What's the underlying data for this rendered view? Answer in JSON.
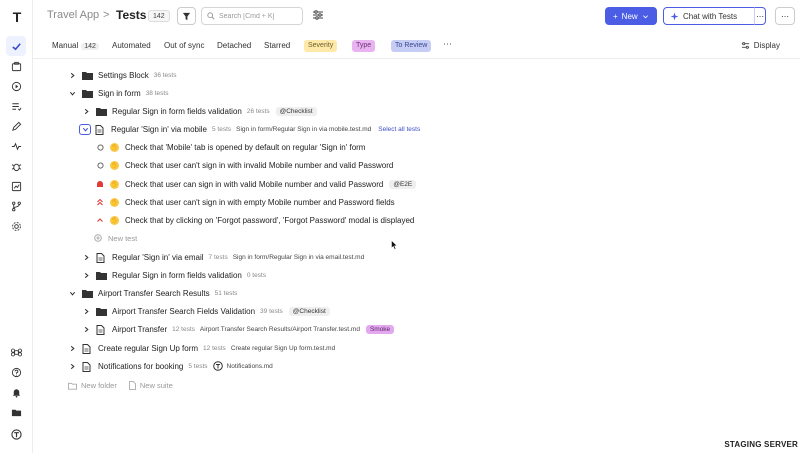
{
  "app": {
    "name": "Travel App",
    "separator": ">",
    "page_title": "Tests",
    "test_count": "142"
  },
  "search": {
    "placeholder": "Search [Cmd + K]"
  },
  "toolbar": {
    "new_label": "New",
    "chat_label": "Chat with Tests",
    "more": "⋯"
  },
  "tabs": {
    "manual": "Manual",
    "manual_count": "142",
    "automated": "Automated",
    "out_of_sync": "Out of sync",
    "detached": "Detached",
    "starred": "Starred",
    "severity": "Severity",
    "type": "Type",
    "to_review": "To Review",
    "more": "⋯",
    "display": "Display"
  },
  "tree": {
    "settings_block": {
      "title": "Settings Block",
      "count": "36 tests"
    },
    "sign_in_form": {
      "title": "Sign in form",
      "count": "38 tests"
    },
    "regular_sign_in_validation": {
      "title": "Regular Sign in form fields validation",
      "count": "26 tests",
      "tag": "@Checklist"
    },
    "via_mobile": {
      "title": "Regular 'Sign in' via mobile",
      "count": "5 tests",
      "path": "Sign in form/Regular Sign in via mobile.test.md",
      "select_all": "Select all tests"
    },
    "tests": [
      {
        "title": "Check that 'Mobile' tab is opened by default on regular 'Sign in' form"
      },
      {
        "title": "Check that user can't sign in with invalid Mobile number and valid Password"
      },
      {
        "title": "Check that user can sign in with valid Mobile number and valid Password",
        "tag": "@E2E"
      },
      {
        "title": "Check that user can't sign in with empty Mobile number and Password fields"
      },
      {
        "title": "Check that by clicking on 'Forgot password', 'Forgot Password' modal is displayed"
      }
    ],
    "new_test": "New test",
    "via_email": {
      "title": "Regular 'Sign in' via email",
      "count": "7 tests",
      "path": "Sign in form/Regular Sign in via email.test.md"
    },
    "fields_validation": {
      "title": "Regular Sign in form fields validation",
      "count": "0 tests"
    },
    "airport_search": {
      "title": "Airport Transfer Search Results",
      "count": "51 tests"
    },
    "airport_fields": {
      "title": "Airport Transfer Search Fields Validation",
      "count": "39 tests",
      "tag": "@Checklist"
    },
    "airport_transfer": {
      "title": "Airport Transfer",
      "count": "12 tests",
      "path": "Airport Transfer Search Results/Airport Transfer.test.md",
      "tag": "Smoke"
    },
    "create_signup": {
      "title": "Create regular Sign Up form",
      "count": "12 tests",
      "path": "Create regular Sign Up form.test.md"
    },
    "notifications": {
      "title": "Notifications for booking",
      "count": "5 tests",
      "path": "Notifications.md"
    },
    "new_folder": "New folder",
    "new_suite": "New suite"
  },
  "footer": {
    "environment": "STAGING SERVER"
  },
  "colors": {
    "accent": "#4b5de4",
    "severity": "#ffe9a8",
    "type": "#e8b3f0",
    "review": "#c6cdf5",
    "critical": "#e03a3a"
  }
}
